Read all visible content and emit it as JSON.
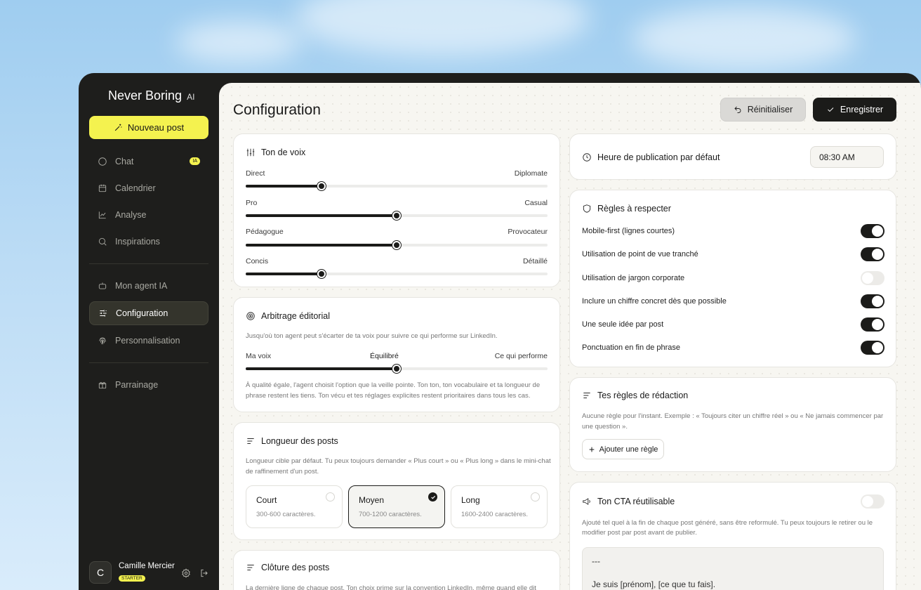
{
  "sidebar": {
    "brand": "Never Boring",
    "brand_suffix": "AI",
    "new_post": "Nouveau post",
    "items": [
      {
        "label": "Chat",
        "badge": "IA"
      },
      {
        "label": "Calendrier"
      },
      {
        "label": "Analyse"
      },
      {
        "label": "Inspirations"
      },
      {
        "label": "Mon agent IA"
      },
      {
        "label": "Configuration",
        "active": true
      },
      {
        "label": "Personnalisation"
      },
      {
        "label": "Parrainage"
      }
    ],
    "user": {
      "initial": "C",
      "name": "Camille Mercier",
      "plan": "STARTER"
    }
  },
  "header": {
    "title": "Configuration",
    "reset_label": "Réinitialiser",
    "save_label": "Enregistrer"
  },
  "tone": {
    "title": "Ton de voix",
    "sliders": [
      {
        "left": "Direct",
        "right": "Diplomate",
        "value": 0.25
      },
      {
        "left": "Pro",
        "right": "Casual",
        "value": 0.5
      },
      {
        "left": "Pédagogue",
        "right": "Provocateur",
        "value": 0.5
      },
      {
        "left": "Concis",
        "right": "Détaillé",
        "value": 0.25
      }
    ]
  },
  "arbitrage": {
    "title": "Arbitrage éditorial",
    "desc": "Jusqu'où ton agent peut s'écarter de ta voix pour suivre ce qui performe sur LinkedIn.",
    "left": "Ma voix",
    "center": "Équilibré",
    "right": "Ce qui performe",
    "value": 0.5,
    "note1": "À qualité égale, l'agent choisit l'option que la veille pointe. Ton ton, ton vocabulaire et ta longueur de",
    "note2": "phrase restent les tiens. Ton vécu et tes réglages explicites restent prioritaires dans tous les cas."
  },
  "length": {
    "title": "Longueur des posts",
    "desc1": "Longueur cible par défaut. Tu peux toujours demander « Plus court » ou « Plus long » dans le mini-chat",
    "desc2": "de raffinement d'un post.",
    "options": [
      {
        "name": "Court",
        "range": "300-600 caractères."
      },
      {
        "name": "Moyen",
        "range": "700-1200 caractères.",
        "selected": true
      },
      {
        "name": "Long",
        "range": "1600-2400 caractères."
      }
    ]
  },
  "closing": {
    "title": "Clôture des posts",
    "desc": "La dernière ligne de chaque post. Ton choix prime sur la convention LinkedIn, même quand elle dit"
  },
  "publish_time": {
    "label": "Heure de publication par défaut",
    "value": "08:30 AM"
  },
  "rules": {
    "title": "Règles à respecter",
    "items": [
      {
        "label": "Mobile-first (lignes courtes)",
        "on": true
      },
      {
        "label": "Utilisation de point de vue tranché",
        "on": true
      },
      {
        "label": "Utilisation de jargon corporate",
        "on": false
      },
      {
        "label": "Inclure un chiffre concret dès que possible",
        "on": true
      },
      {
        "label": "Une seule idée par post",
        "on": true
      },
      {
        "label": "Ponctuation en fin de phrase",
        "on": true
      }
    ]
  },
  "writing_rules": {
    "title": "Tes règles de rédaction",
    "desc1": "Aucune règle pour l'instant. Exemple : « Toujours citer un chiffre réel » ou « Ne jamais commencer par",
    "desc2": "une question ».",
    "add_label": "Ajouter une règle"
  },
  "cta": {
    "title": "Ton CTA réutilisable",
    "on": false,
    "desc1": "Ajouté tel quel à la fin de chaque post généré, sans être reformulé. Tu peux toujours le retirer ou le",
    "desc2": "modifier post par post avant de publier.",
    "line1": "---",
    "line2": "Je suis [prénom], [ce que tu fais]."
  }
}
